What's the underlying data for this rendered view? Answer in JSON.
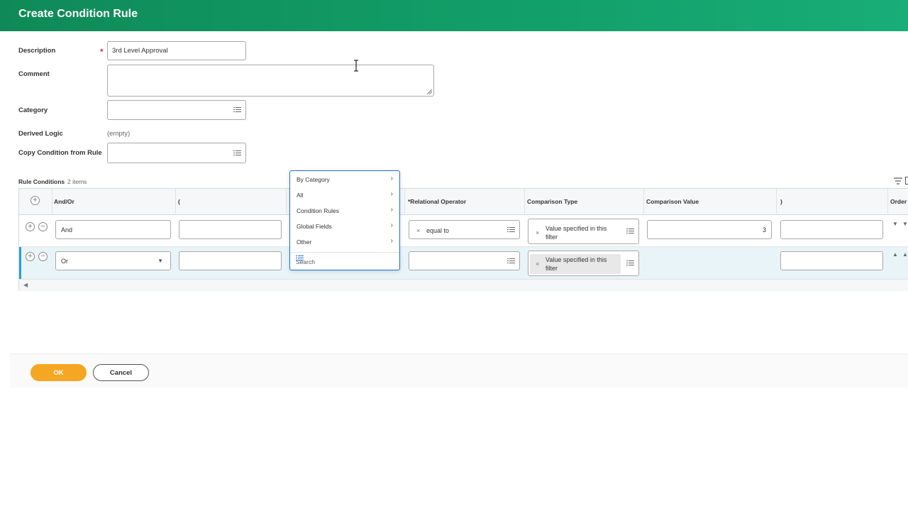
{
  "page": {
    "title": "Create Condition Rule"
  },
  "form": {
    "description_label": "Description",
    "description_required": "*",
    "description_value": "3rd Level Approval",
    "comment_label": "Comment",
    "comment_value": "",
    "category_label": "Category",
    "derived_logic_label": "Derived Logic",
    "derived_logic_value": "(empty)",
    "copy_condition_label": "Copy Condition from Rule"
  },
  "rule_conditions": {
    "title": "Rule Conditions",
    "count": "2 items",
    "columns": {
      "and_or": "And/Or",
      "open_paren": "(",
      "relational_operator": "*Relational Operator",
      "comparison_type": "Comparison Type",
      "comparison_value": "Comparison Value",
      "close_paren": ")",
      "order": "Order"
    },
    "rows": [
      {
        "and_or": "And",
        "relational_operator": "equal to",
        "comparison_type": "Value specified in this filter",
        "comparison_value": "3"
      },
      {
        "and_or": "Or",
        "relational_operator": "",
        "comparison_type": "Value specified in this filter",
        "comparison_value": ""
      }
    ]
  },
  "dropdown": {
    "items": [
      "By Category",
      "All",
      "Condition Rules",
      "Global Fields",
      "Other"
    ],
    "search_placeholder": "Search"
  },
  "footer": {
    "ok_label": "OK",
    "cancel_label": "Cancel"
  },
  "colors": {
    "header": "#12a06a",
    "ok_button": "#f5a623",
    "selection_blue": "#1e6fd0",
    "required": "#d9363e"
  }
}
